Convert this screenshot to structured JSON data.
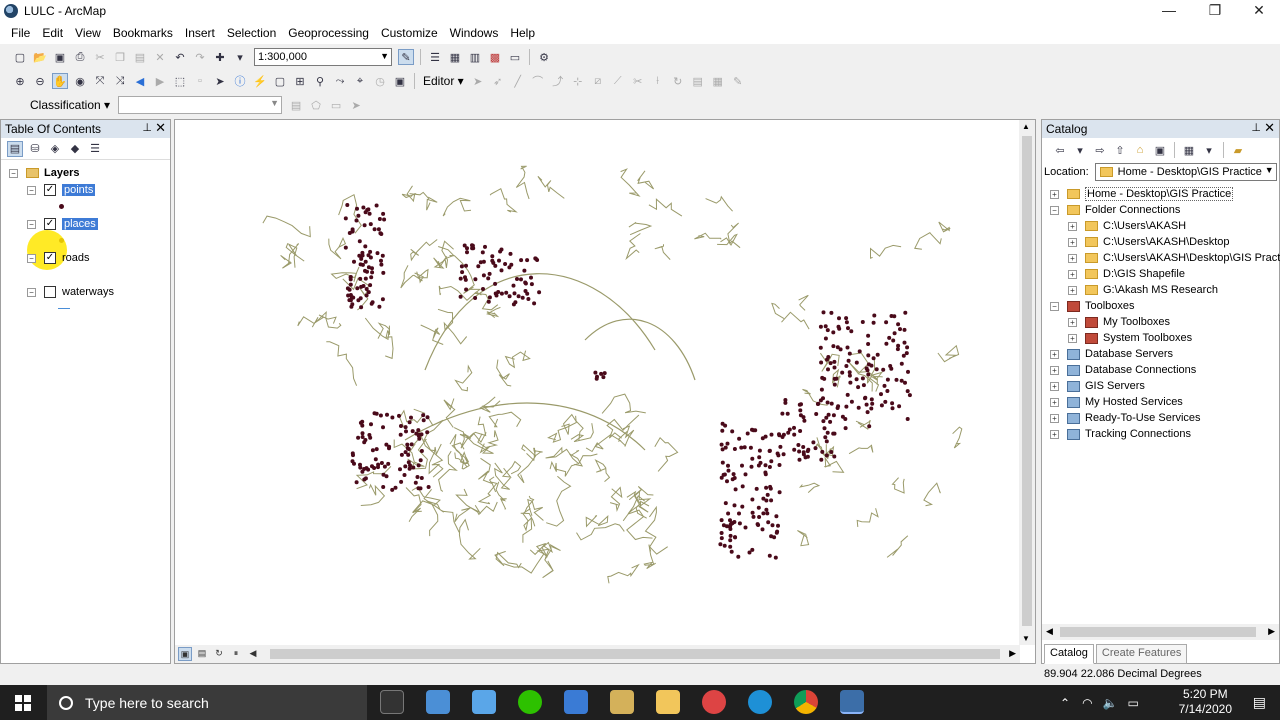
{
  "window": {
    "title": "LULC - ArcMap",
    "minimize": "—",
    "maximize": "❐",
    "close": "✕"
  },
  "menu": [
    "File",
    "Edit",
    "View",
    "Bookmarks",
    "Insert",
    "Selection",
    "Geoprocessing",
    "Customize",
    "Windows",
    "Help"
  ],
  "toolbar": {
    "scale": "1:300,000",
    "editor_label": "Editor ▾",
    "classification_label": "Classification ▾"
  },
  "toc": {
    "title": "Table Of Contents",
    "root": "Layers",
    "layers": [
      {
        "name": "points",
        "checked": true,
        "selected": true
      },
      {
        "name": "places",
        "checked": true,
        "selected": true
      },
      {
        "name": "roads",
        "checked": true,
        "selected": false
      },
      {
        "name": "waterways",
        "checked": false,
        "selected": false
      }
    ]
  },
  "catalog": {
    "title": "Catalog",
    "location_label": "Location:",
    "location_value": "Home - Desktop\\GIS Practice",
    "items": [
      {
        "label": "Home - Desktop\\GIS Practice",
        "icon": "folder-home-icon",
        "indent": 0,
        "expander": "+"
      },
      {
        "label": "Folder Connections",
        "icon": "folder-icon",
        "indent": 0,
        "expander": "−"
      },
      {
        "label": "C:\\Users\\AKASH",
        "icon": "folder-icon",
        "indent": 1,
        "expander": "+"
      },
      {
        "label": "C:\\Users\\AKASH\\Desktop",
        "icon": "folder-icon",
        "indent": 1,
        "expander": "+"
      },
      {
        "label": "C:\\Users\\AKASH\\Desktop\\GIS Practice",
        "icon": "folder-icon",
        "indent": 1,
        "expander": "+"
      },
      {
        "label": "D:\\GIS Shapefile",
        "icon": "folder-icon",
        "indent": 1,
        "expander": "+"
      },
      {
        "label": "G:\\Akash MS Research",
        "icon": "folder-icon",
        "indent": 1,
        "expander": "+"
      },
      {
        "label": "Toolboxes",
        "icon": "toolbox-icon",
        "indent": 0,
        "expander": "−"
      },
      {
        "label": "My Toolboxes",
        "icon": "toolbox-icon",
        "indent": 1,
        "expander": "+"
      },
      {
        "label": "System Toolboxes",
        "icon": "toolbox-icon",
        "indent": 1,
        "expander": "+"
      },
      {
        "label": "Database Servers",
        "icon": "server-icon",
        "indent": 0,
        "expander": "+"
      },
      {
        "label": "Database Connections",
        "icon": "server-icon",
        "indent": 0,
        "expander": "+"
      },
      {
        "label": "GIS Servers",
        "icon": "server-icon",
        "indent": 0,
        "expander": "+"
      },
      {
        "label": "My Hosted Services",
        "icon": "server-icon",
        "indent": 0,
        "expander": "+"
      },
      {
        "label": "Ready-To-Use Services",
        "icon": "server-icon",
        "indent": 0,
        "expander": "+"
      },
      {
        "label": "Tracking Connections",
        "icon": "server-icon",
        "indent": 0,
        "expander": "+"
      }
    ],
    "tabs": [
      "Catalog",
      "Create Features"
    ]
  },
  "status": {
    "coordinates": "89.904  22.086 Decimal Degrees"
  },
  "taskbar": {
    "search_placeholder": "Type here to search",
    "time": "5:20 PM",
    "date": "7/14/2020"
  },
  "colors": {
    "points": "#4a0a1a",
    "roads": "#8a8a5a",
    "selection": "#3e7bd6",
    "taskbar": "#1f1f1f"
  }
}
